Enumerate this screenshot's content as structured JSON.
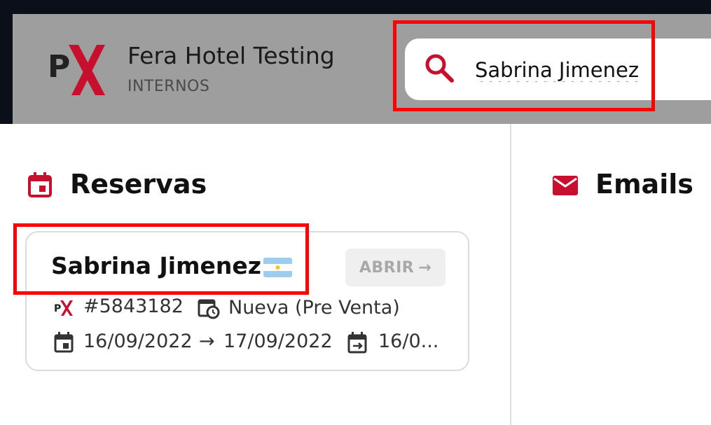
{
  "header": {
    "logo_letter": "P",
    "app_title": "Fera Hotel Testing",
    "app_subtitle": "INTERNOS",
    "search_value": "Sabrina Jimenez"
  },
  "sections": {
    "reservas_title": "Reservas",
    "emails_title": "Emails"
  },
  "reservation": {
    "guest_name": "Sabrina Jimenez",
    "open_label": "ABRIR",
    "open_arrow": "→",
    "booking_id": "#5843182",
    "status": "Nueva (Pre Venta)",
    "check_in": "16/09/2022",
    "arrow": "→",
    "check_out": "17/09/2022",
    "extra_date": "16/0..."
  },
  "colors": {
    "accent": "#c8102e",
    "header_bg": "#9e9e9e",
    "highlight": "#ff0000"
  }
}
